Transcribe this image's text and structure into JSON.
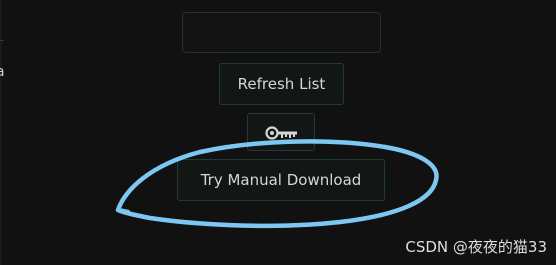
{
  "left_panel": {
    "partial_char": "a"
  },
  "form": {
    "input_value": "",
    "refresh_label": "Refresh List",
    "key_button_icon": "key-icon",
    "manual_download_label": "Try Manual Download"
  },
  "annotation": {
    "shape": "hand-drawn ellipse",
    "color": "#7cc8f2"
  },
  "watermark": {
    "text": "CSDN @夜夜的猫33"
  },
  "colors": {
    "background": "#111111",
    "button_border": "#1f3d37",
    "button_text": "#d6d6d6"
  }
}
